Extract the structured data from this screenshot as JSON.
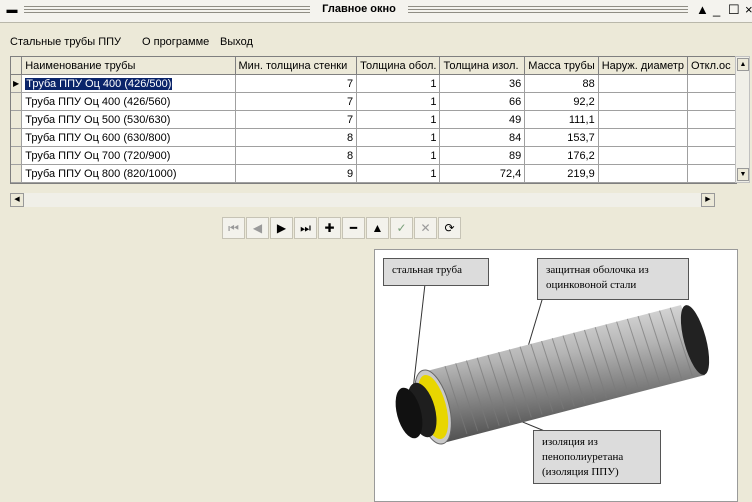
{
  "window": {
    "title": "Главное окно",
    "system_menu_glyph": "▬",
    "controls": [
      "▲",
      "_",
      "☐",
      "×"
    ]
  },
  "menu": {
    "items": [
      "Стальные трубы ППУ",
      "О программе",
      "Выход"
    ]
  },
  "table": {
    "columns": [
      "Наименование трубы",
      "Мин. толщина стенки",
      "Толщина обол.",
      "Толщина изол.",
      "Масса трубы",
      "Наруж. диаметр",
      "Откл.ос"
    ],
    "rows": [
      [
        "Труба ППУ Оц 400 (426/500)",
        "7",
        "1",
        "36",
        "88",
        "",
        ""
      ],
      [
        "Труба ППУ Оц 400 (426/560)",
        "7",
        "1",
        "66",
        "92,2",
        "",
        ""
      ],
      [
        "Труба ППУ Оц 500 (530/630)",
        "7",
        "1",
        "49",
        "111,1",
        "",
        ""
      ],
      [
        "Труба ППУ Оц 600 (630/800)",
        "8",
        "1",
        "84",
        "153,7",
        "",
        ""
      ],
      [
        "Труба ППУ Оц 700 (720/900)",
        "8",
        "1",
        "89",
        "176,2",
        "",
        ""
      ],
      [
        "Труба ППУ Оц 800 (820/1000)",
        "9",
        "1",
        "72,4",
        "219,9",
        "",
        ""
      ]
    ],
    "selected_row": 0,
    "row_indicator": "▶"
  },
  "navigator": {
    "buttons": [
      {
        "name": "first-record-button",
        "glyph": "⏮",
        "style": "dim"
      },
      {
        "name": "prior-record-button",
        "glyph": "◀",
        "style": "dim"
      },
      {
        "name": "next-record-button",
        "glyph": "▶",
        "style": ""
      },
      {
        "name": "last-record-button",
        "glyph": "⏭",
        "style": ""
      },
      {
        "name": "insert-record-button",
        "glyph": "✚",
        "style": ""
      },
      {
        "name": "delete-record-button",
        "glyph": "━",
        "style": ""
      },
      {
        "name": "edit-record-button",
        "glyph": "▲",
        "style": ""
      },
      {
        "name": "post-edit-button",
        "glyph": "✓",
        "style": "grn"
      },
      {
        "name": "cancel-edit-button",
        "glyph": "✕",
        "style": "dim"
      },
      {
        "name": "refresh-button",
        "glyph": "⟳",
        "style": ""
      }
    ]
  },
  "picture": {
    "callouts": {
      "steel_pipe": "стальная труба",
      "shell": "защитная оболочка из оцинковоной стали",
      "insulation": "изоляция из пенополиуретана (изоляция ППУ)"
    }
  },
  "colors": {
    "window_bg": "#ece9d8",
    "selection": "#0a246a",
    "grid_bg": "#ffffff"
  }
}
